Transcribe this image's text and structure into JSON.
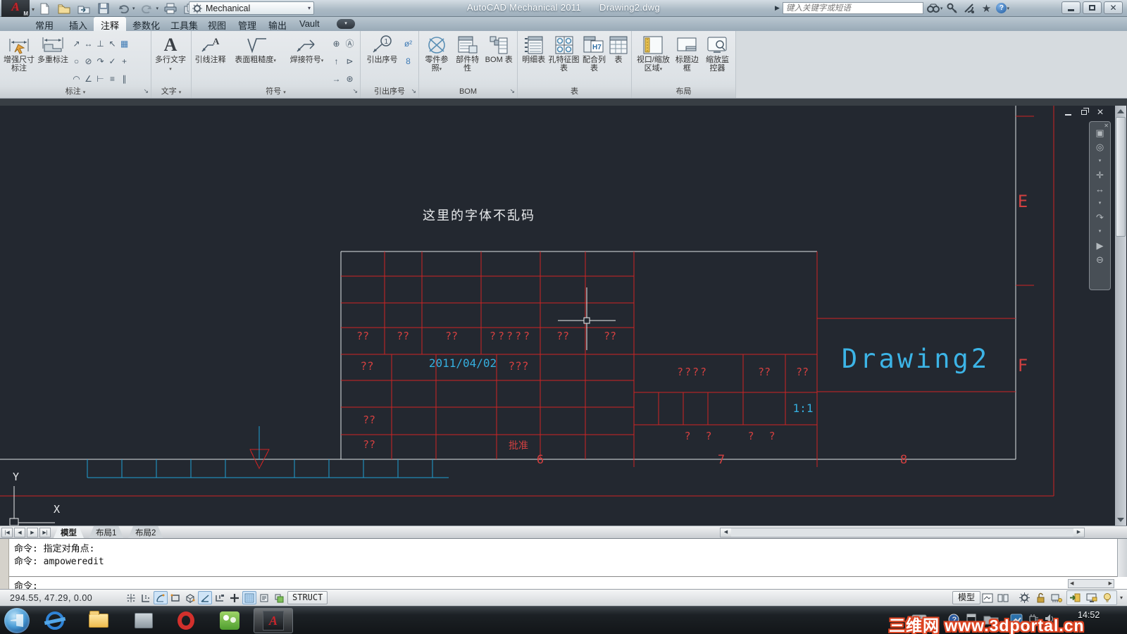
{
  "window": {
    "title_app": "AutoCAD Mechanical 2011",
    "title_doc": "Drawing2.dwg",
    "search_placeholder": "键入关键字或短语",
    "logo_letter": "A",
    "logo_sub": "M"
  },
  "qat": {
    "workspace": "Mechanical"
  },
  "ribbon": {
    "tabs": [
      "常用",
      "插入",
      "注释",
      "参数化",
      "工具集",
      "视图",
      "管理",
      "输出",
      "Vault"
    ],
    "dim": {
      "b1": "增强尺寸标注",
      "b2": "多重标注",
      "footer": "标注"
    },
    "text": {
      "b1": "多行文字",
      "footer": "文字"
    },
    "sym": {
      "b1": "引线注释",
      "b2": "表面粗糙度",
      "b3": "焊接符号",
      "footer": "符号"
    },
    "balloon": {
      "b1": "引出序号",
      "footer": "引出序号",
      "s1": "ø²",
      "s2": "8"
    },
    "bom": {
      "b1": "零件参照",
      "b2": "部件特性",
      "b3": "BOM 表",
      "footer": "BOM"
    },
    "table": {
      "b1": "明细表",
      "b2": "孔特征图表",
      "b3": "配合列表",
      "b4": "表",
      "footer": "表",
      "h7": "H7"
    },
    "layout": {
      "b1": "视口/缩放区域",
      "b2": "标题边框",
      "b3": "缩放监控器",
      "footer": "布局"
    },
    "dim_grid": [
      "↗",
      "↔",
      "⊥",
      "↖",
      "▦",
      "○",
      "⊘",
      "↷",
      "✓",
      "+",
      "◠",
      "∠",
      "⊢",
      "≡",
      "∥"
    ],
    "sym_grid": [
      "⊕",
      "Ⓐ",
      "↑",
      "⊳",
      "→",
      "⊛"
    ]
  },
  "drawing": {
    "note": "这里的字体不乱码",
    "r1": [
      "??",
      "??",
      "??",
      "?????",
      "??",
      "??"
    ],
    "r2_left": "??",
    "date": "2011/04/02",
    "r2_mid": "???",
    "r4_left": "??",
    "r5_left": "??",
    "approve": "批准",
    "rt_desc": "????",
    "rt_c2": "??",
    "rt_c3": "??",
    "scale": "1:1",
    "qa": "? ?",
    "qb": "? ?",
    "title": "Drawing2",
    "zone_e": "E",
    "zone_f": "F",
    "z6": "6",
    "z7": "7",
    "z8": "8",
    "ucs_x": "X",
    "ucs_y": "Y"
  },
  "tabsbar": {
    "model": "模型",
    "layout1": "布局1",
    "layout2": "布局2"
  },
  "command": {
    "l1": "命令: 指定对角点:",
    "l2": "命令: ampoweredit",
    "current": "命令:"
  },
  "status": {
    "coords": "294.55, 47.29, 0.00",
    "struct": "STRUCT",
    "model": "模型"
  },
  "taskbar": {
    "clock": "14:52",
    "watermark": "三维网 www.3dportal.cn"
  },
  "icons": {
    "dropdown": "▾",
    "launcher": "↘",
    "help": "?",
    "one": "1"
  },
  "colors": {
    "cad_red": "#cf2323",
    "cad_cyan": "#2aa7d6",
    "canvas_bg": "#232830"
  }
}
